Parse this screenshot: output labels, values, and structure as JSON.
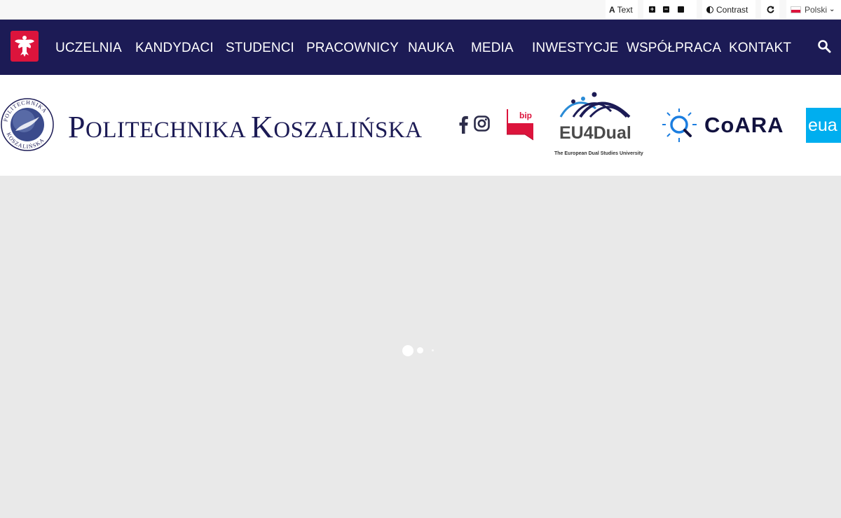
{
  "topbar": {
    "text_glyph": "A",
    "text_label": "Text",
    "size_increase_icon": "plus-square-icon",
    "size_decrease_icon": "minus-square-icon",
    "size_reset_icon": "square-icon",
    "contrast_label": "Contrast",
    "reset_icon": "refresh-icon",
    "language_label": "Polski"
  },
  "nav": {
    "items": [
      "UCZELNIA",
      "KANDYDACI",
      "STUDENCI",
      "PRACOWNICY",
      "NAUKA",
      "MEDIA",
      "INWESTYCJE",
      "WSPÓŁPRACA",
      "KONTAKT"
    ],
    "search_icon": "search-icon"
  },
  "header": {
    "title_first_initial": "P",
    "title_first_rest": "OLITECHNIKA",
    "title_second_initial": "K",
    "title_second_rest": "OSZALIŃSKA",
    "seal_text_top": "POLITECHNIKA",
    "seal_text_bottom": "KOSZALIŃSKA",
    "bip_label": "bip",
    "eu4dual_label": "EU4Dual",
    "eu4dual_sub": "The European Dual Studies University",
    "coara_label": "CoARA",
    "eua_label": "eua"
  },
  "colors": {
    "nav_bg": "#1c1b55",
    "title": "#1c1b55",
    "eua": "#00aeef",
    "bip_red": "#dc143c",
    "loader_bg": "#e9e9e9"
  }
}
